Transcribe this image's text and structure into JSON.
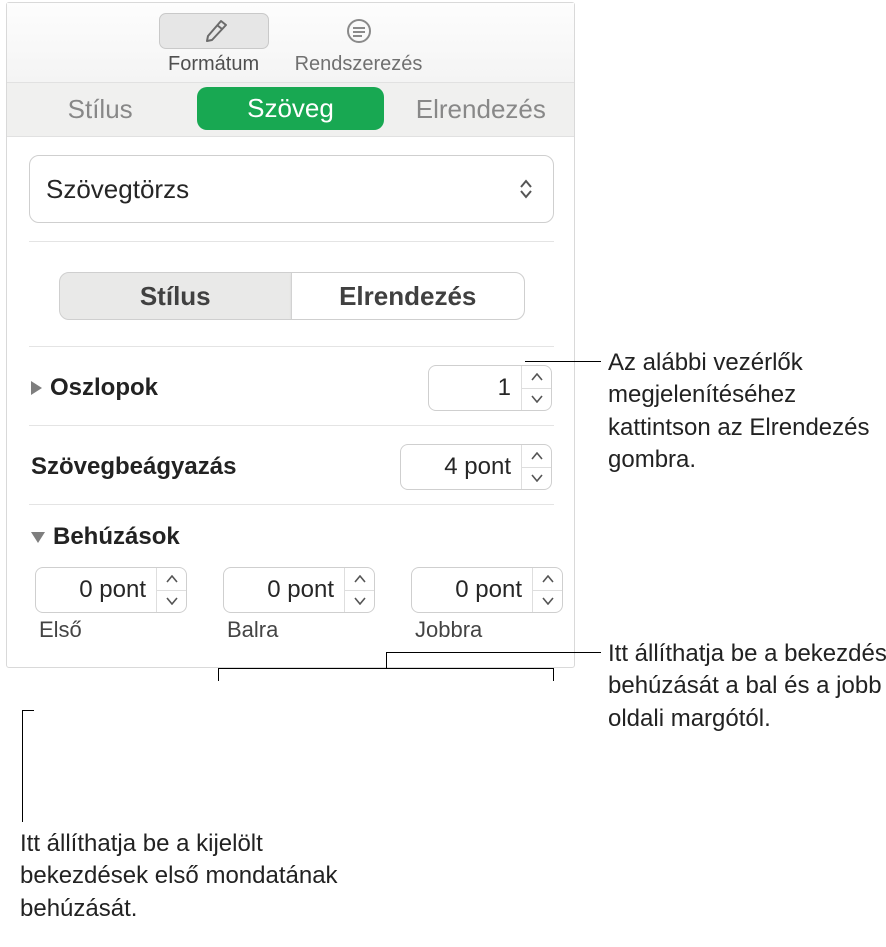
{
  "toolbar": {
    "format_label": "Formátum",
    "organize_label": "Rendszerezés"
  },
  "tabs": {
    "style": "Stílus",
    "text": "Szöveg",
    "layout": "Elrendezés"
  },
  "body_style_select": "Szövegtörzs",
  "segmented": {
    "style": "Stílus",
    "layout": "Elrendezés"
  },
  "columns": {
    "label": "Oszlopok",
    "value": "1"
  },
  "text_inset": {
    "label": "Szövegbeágyazás",
    "value": "4 pont"
  },
  "indents": {
    "label": "Behúzások",
    "first": {
      "value": "0 pont",
      "caption": "Első"
    },
    "left": {
      "value": "0 pont",
      "caption": "Balra"
    },
    "right": {
      "value": "0 pont",
      "caption": "Jobbra"
    }
  },
  "callouts": {
    "layout_btn": "Az alábbi vezérlők megjelenítéséhez kattintson az Elrendezés gombra.",
    "lr_margin": "Itt állíthatja be a bekezdés behúzását a bal és a jobb oldali margótól.",
    "first_line": "Itt állíthatja be a kijelölt bekezdések első mondatának behúzását."
  }
}
